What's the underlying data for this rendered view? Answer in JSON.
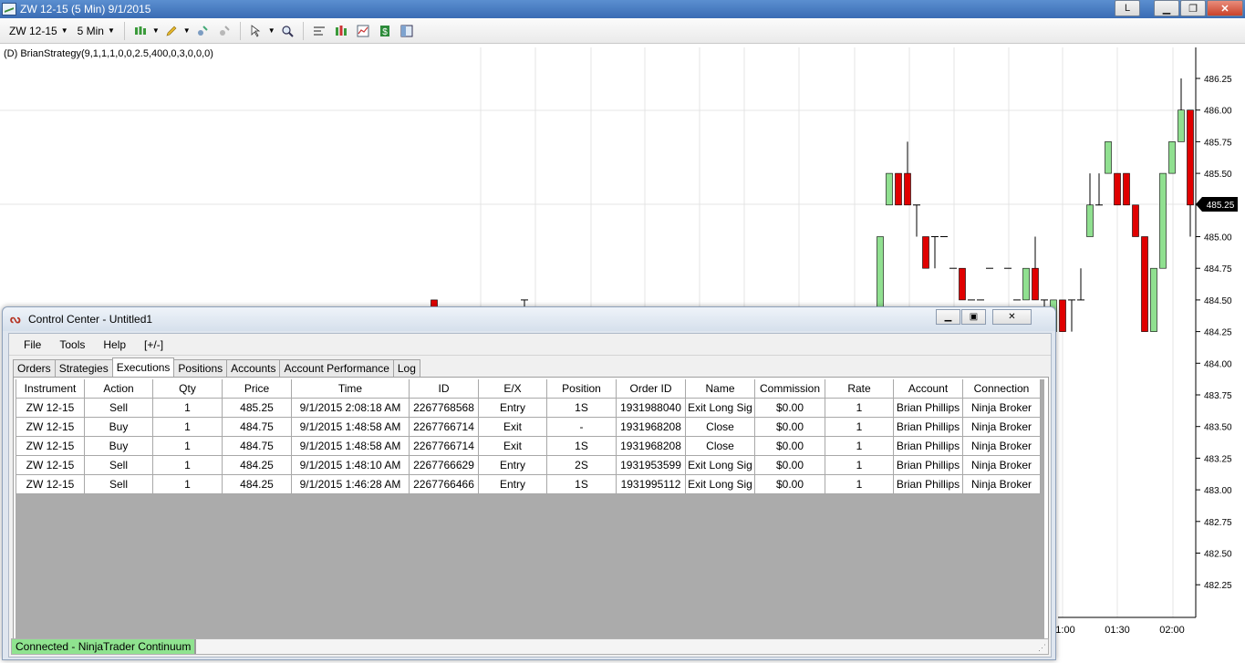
{
  "window": {
    "title": "ZW 12-15 (5 Min)  9/1/2015",
    "btn_l": "L",
    "btn_min": "▁",
    "btn_max": "❐",
    "btn_close": "✕"
  },
  "toolbar": {
    "instrument": "ZW 12-15",
    "interval": "5 Min",
    "icons": [
      "bar-type-icon",
      "drawing-pencil-icon",
      "indicator-add-icon",
      "strategy-icon",
      "pointer-icon",
      "zoom-icon",
      "properties-icon",
      "data-box-icon",
      "chart-trader-icon",
      "order-icon",
      "split-window-icon"
    ]
  },
  "chart": {
    "strategy_label": "(D) BrianStrategy(9,1,1,1,0,0,2.5,400,0,3,0,0,0)",
    "current_price": "485.25",
    "price_labels": [
      "486.25",
      "486.00",
      "485.75",
      "485.50",
      "485.25",
      "485.00",
      "484.75",
      "484.50",
      "484.25",
      "484.00",
      "483.75",
      "483.50",
      "483.25",
      "483.00",
      "482.75",
      "482.50",
      "482.25"
    ],
    "time_labels": [
      "1:00",
      "01:30",
      "02:00"
    ],
    "colors": {
      "up": "#90e090",
      "down": "#e00000",
      "grid": "#e4e4e4",
      "marker": "#000000"
    }
  },
  "control_center": {
    "title": "Control Center - Untitled1",
    "menu": [
      "File",
      "Tools",
      "Help",
      "[+/-]"
    ],
    "tabs": [
      "Orders",
      "Strategies",
      "Executions",
      "Positions",
      "Accounts",
      "Account Performance",
      "Log"
    ],
    "active_tab": "Executions",
    "columns": [
      "Instrument",
      "Action",
      "Qty",
      "Price",
      "Time",
      "ID",
      "E/X",
      "Position",
      "Order ID",
      "Name",
      "Commission",
      "Rate",
      "Account",
      "Connection"
    ],
    "rows": [
      [
        "ZW 12-15",
        "Sell",
        "1",
        "485.25",
        "9/1/2015 2:08:18 AM",
        "2267768568",
        "Entry",
        "1S",
        "1931988040",
        "Exit Long Sig",
        "$0.00",
        "1",
        "Brian Phillips",
        "Ninja Broker"
      ],
      [
        "ZW 12-15",
        "Buy",
        "1",
        "484.75",
        "9/1/2015 1:48:58 AM",
        "2267766714",
        "Exit",
        "-",
        "1931968208",
        "Close",
        "$0.00",
        "1",
        "Brian Phillips",
        "Ninja Broker"
      ],
      [
        "ZW 12-15",
        "Buy",
        "1",
        "484.75",
        "9/1/2015 1:48:58 AM",
        "2267766714",
        "Exit",
        "1S",
        "1931968208",
        "Close",
        "$0.00",
        "1",
        "Brian Phillips",
        "Ninja Broker"
      ],
      [
        "ZW 12-15",
        "Sell",
        "1",
        "484.25",
        "9/1/2015 1:48:10 AM",
        "2267766629",
        "Entry",
        "2S",
        "1931953599",
        "Exit Long Sig",
        "$0.00",
        "1",
        "Brian Phillips",
        "Ninja Broker"
      ],
      [
        "ZW 12-15",
        "Sell",
        "1",
        "484.25",
        "9/1/2015 1:46:28 AM",
        "2267766466",
        "Entry",
        "1S",
        "1931995112",
        "Exit Long Sig",
        "$0.00",
        "1",
        "Brian Phillips",
        "Ninja Broker"
      ]
    ],
    "status": "Connected - NinjaTrader Continuum"
  }
}
